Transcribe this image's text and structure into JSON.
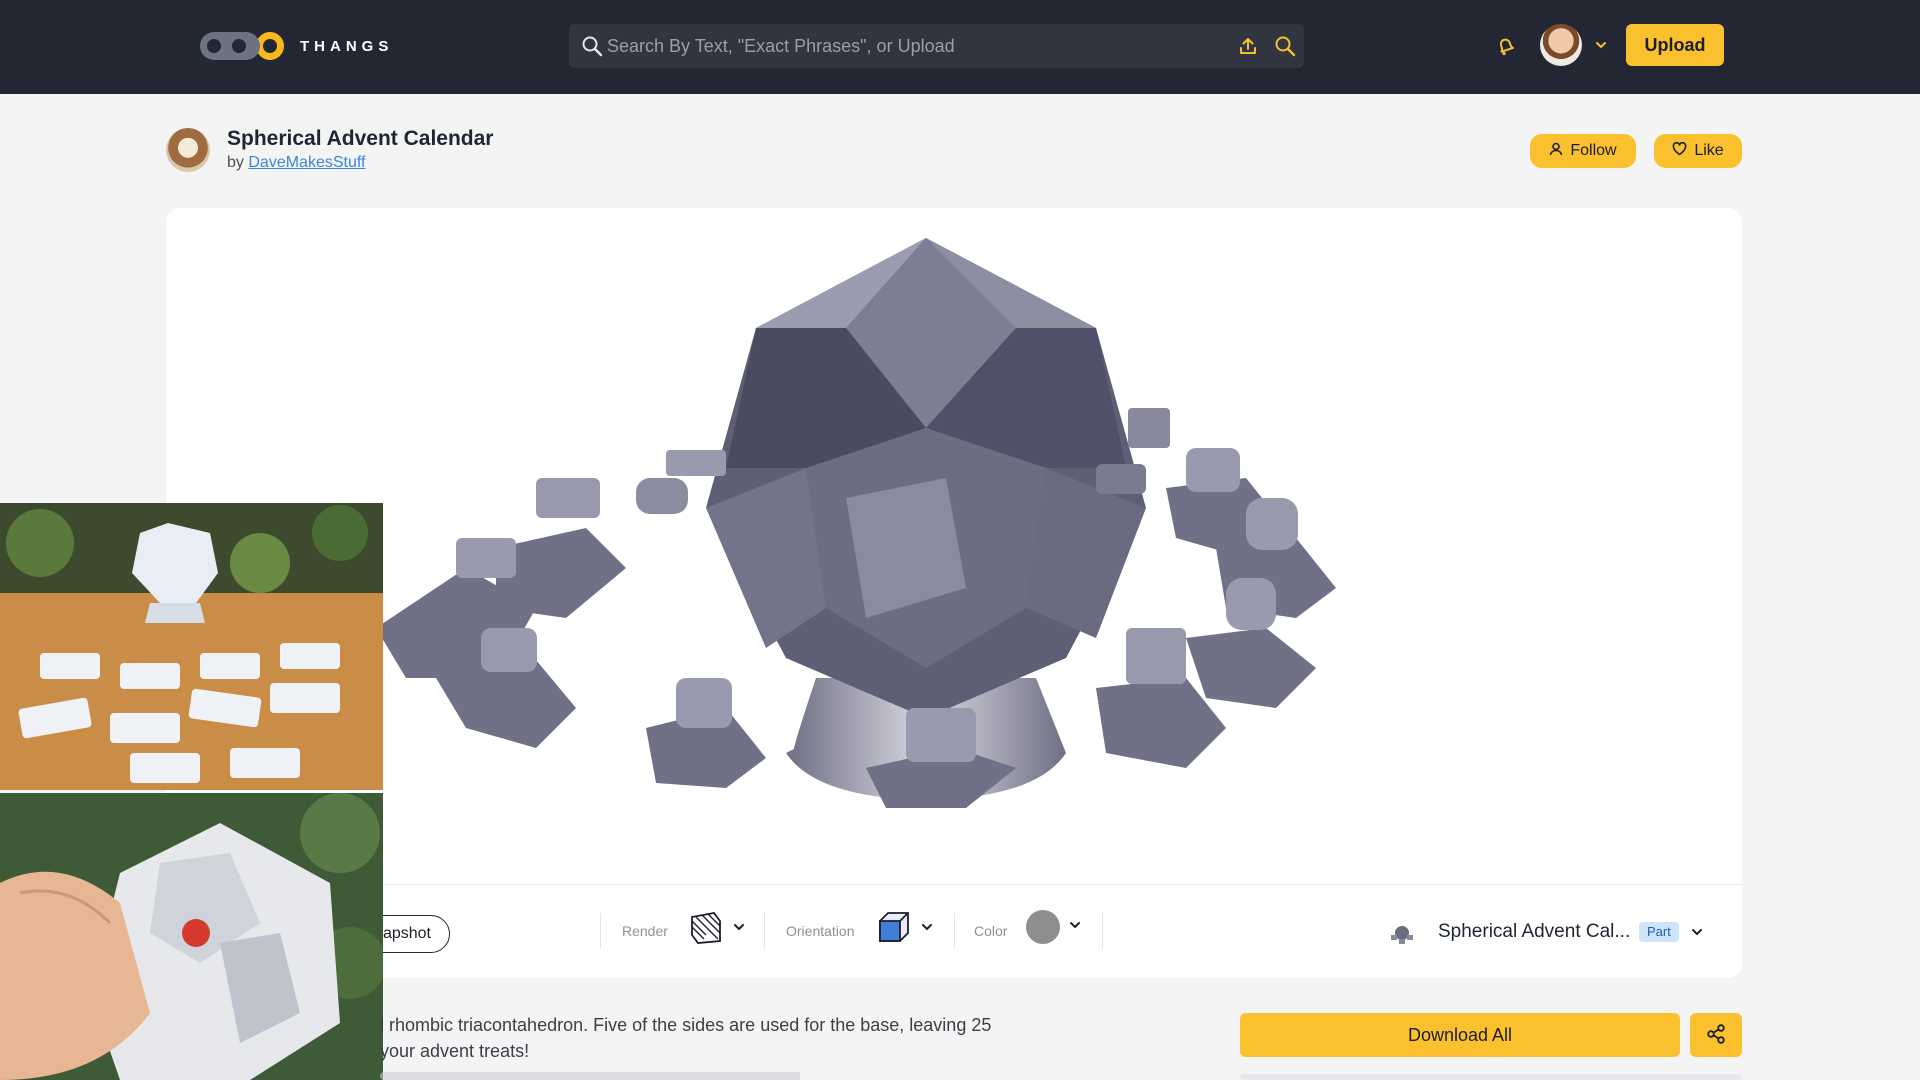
{
  "brand": {
    "name": "THANGS"
  },
  "search": {
    "placeholder": "Search By Text, \"Exact Phrases\", or Upload"
  },
  "header": {
    "upload_label": "Upload"
  },
  "model": {
    "title": "Spherical Advent Calendar",
    "by_prefix": "by",
    "author": "DaveMakesStuff",
    "follow_label": "Follow",
    "like_label": "Like"
  },
  "toolbar": {
    "snapshot_label": "apshot",
    "render_label": "Render",
    "orientation_label": "Orientation",
    "color_label": "Color",
    "part_name": "Spherical Advent Cal...",
    "part_badge": "Part"
  },
  "description": {
    "line1": "l rhombic triacontahedron. Five of the sides are used for the base, leaving 25",
    "line2": "your advent treats!"
  },
  "actions": {
    "download_all_label": "Download All"
  },
  "colors": {
    "accent": "#fbc02d",
    "topbar": "#222733",
    "link": "#3a86d8"
  }
}
